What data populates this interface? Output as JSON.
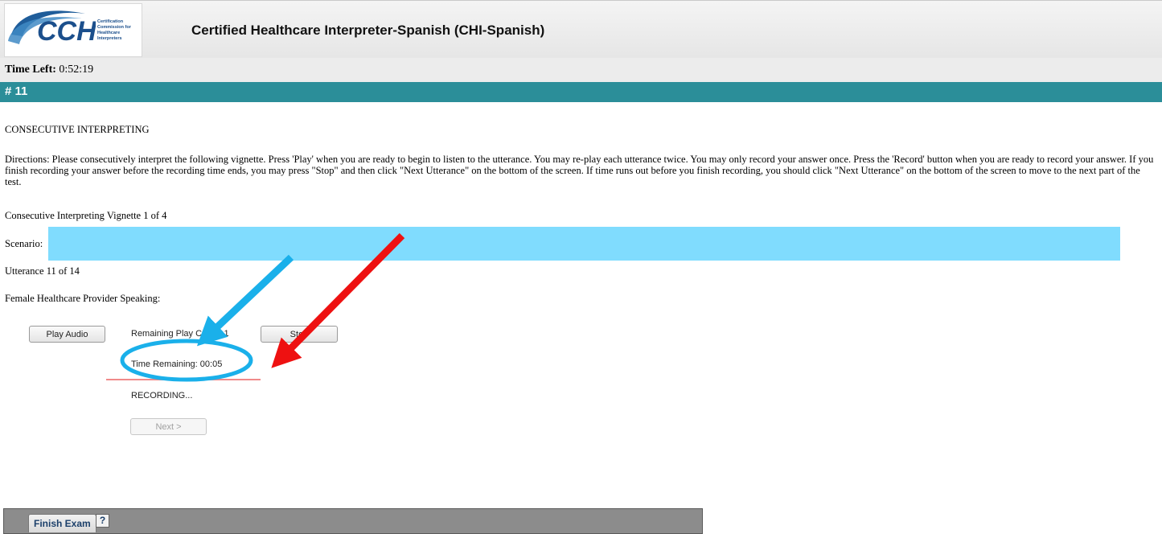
{
  "header": {
    "logo_text": "CCHI",
    "logo_subtext": "Certification Commission for Healthcare Interpreters",
    "exam_title": "Certified Healthcare Interpreter-Spanish (CHI-Spanish)"
  },
  "timer": {
    "label": "Time Left:",
    "value": "0:52:19"
  },
  "question": {
    "number": "# 11"
  },
  "content": {
    "section_title": "CONSECUTIVE INTERPRETING",
    "directions": "Directions: Please consecutively interpret the following vignette. Press 'Play' when you are ready to begin to listen to the utterance. You may re-play each utterance twice. You may only record your answer once. Press the 'Record' button when you are ready to record your answer. If you finish recording your answer before the recording time ends, you may press \"Stop\" and then click \"Next Utterance\" on the bottom of the screen. If time runs out before you finish recording, you should click \"Next Utterance\" on the bottom of the screen to move to the next part of the test.",
    "vignette": "Consecutive Interpreting Vignette 1 of 4",
    "scenario_label": "Scenario:",
    "utterance": "Utterance 11 of 14",
    "speaker": "Female Healthcare Provider Speaking:"
  },
  "controls": {
    "play_label": "Play Audio",
    "remaining_play_count": "Remaining Play Count: 1",
    "stop_label": "Stop",
    "time_remaining": "Time Remaining: 00:05",
    "status": "RECORDING...",
    "next_label": "Next >"
  },
  "footer": {
    "finish_label": "Finish Exam",
    "help_label": "?"
  },
  "colors": {
    "teal": "#2b8e99",
    "highlight": "#80dcfe",
    "annotation_blue": "#1ab0ea",
    "annotation_red": "#ee1111"
  }
}
